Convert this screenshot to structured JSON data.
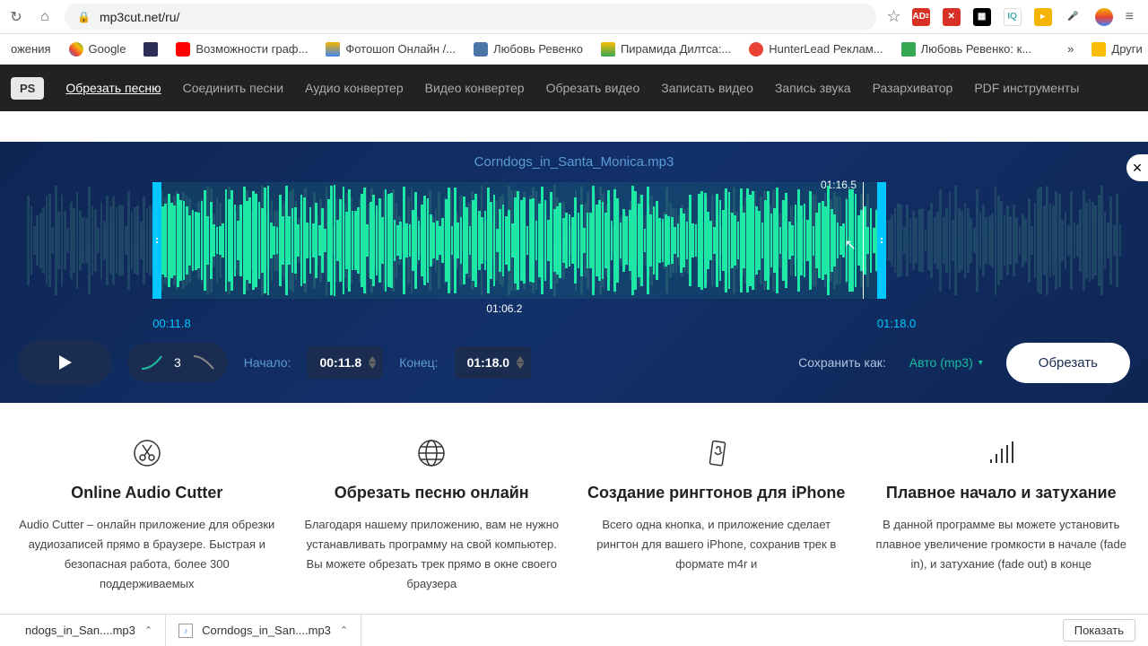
{
  "browser": {
    "url": "mp3cut.net/ru/",
    "star": "☆",
    "ext_icons": [
      {
        "bg": "#d93025",
        "txt": "AD"
      },
      {
        "bg": "#d93025",
        "txt": "✕"
      },
      {
        "bg": "#000",
        "txt": ""
      },
      {
        "bg": "#fff",
        "txt": "IQ",
        "color": "#4aa"
      },
      {
        "bg": "#f90",
        "txt": ""
      },
      {
        "bg": "#4285f4",
        "txt": "🎤"
      },
      {
        "bg": "#fff",
        "txt": "●"
      }
    ]
  },
  "bookmarks": {
    "prefix": "ожения",
    "items": [
      {
        "label": "Google"
      },
      {
        "label": ""
      },
      {
        "label": "Возможности граф..."
      },
      {
        "label": "Фотошоп Онлайн /..."
      },
      {
        "label": "Любовь Ревенко"
      },
      {
        "label": "Пирамида Дилтса:..."
      },
      {
        "label": "HunterLead Реклам..."
      },
      {
        "label": "Любовь Ревенко: к..."
      }
    ],
    "more": "»",
    "other": "Други"
  },
  "nav": {
    "pps": "PS",
    "items": [
      "Обрезать песню",
      "Соединить песни",
      "Аудио конвертер",
      "Видео конвертер",
      "Обрезать видео",
      "Записать видео",
      "Запись звука",
      "Разархиватор",
      "PDF инструменты"
    ]
  },
  "editor": {
    "filename": "Corndogs_in_Santa_Monica.mp3",
    "playhead_time": "01:16.5",
    "mid_time": "01:06.2",
    "start_time": "00:11.8",
    "end_time": "01:18.0",
    "start_label": "Начало:",
    "end_label": "Конец:",
    "fade_value": "3",
    "save_as": "Сохранить как:",
    "format": "Авто (mp3)",
    "cut": "Обрезать"
  },
  "features": [
    {
      "title": "Online Audio Cutter",
      "text": "Audio Cutter – онлайн приложение для обрезки аудиозаписей прямо в браузере. Быстрая и безопасная работа, более 300 поддерживаемых"
    },
    {
      "title": "Обрезать песню онлайн",
      "text": "Благодаря нашему приложению, вам не нужно устанавливать программу на свой компьютер. Вы можете обрезать трек прямо в окне своего браузера"
    },
    {
      "title": "Создание рингтонов для iPhone",
      "text": "Всего одна кнопка, и приложение сделает рингтон для вашего iPhone, сохранив трек в формате m4r и"
    },
    {
      "title": "Плавное начало и затухание",
      "text": "В данной программе вы можете установить плавное увеличение громкости в начале (fade in), и затухание (fade out) в конце"
    }
  ],
  "downloads": {
    "items": [
      {
        "name": "ndogs_in_San....mp3"
      },
      {
        "name": "Corndogs_in_San....mp3"
      }
    ],
    "show_all": "Показать"
  }
}
